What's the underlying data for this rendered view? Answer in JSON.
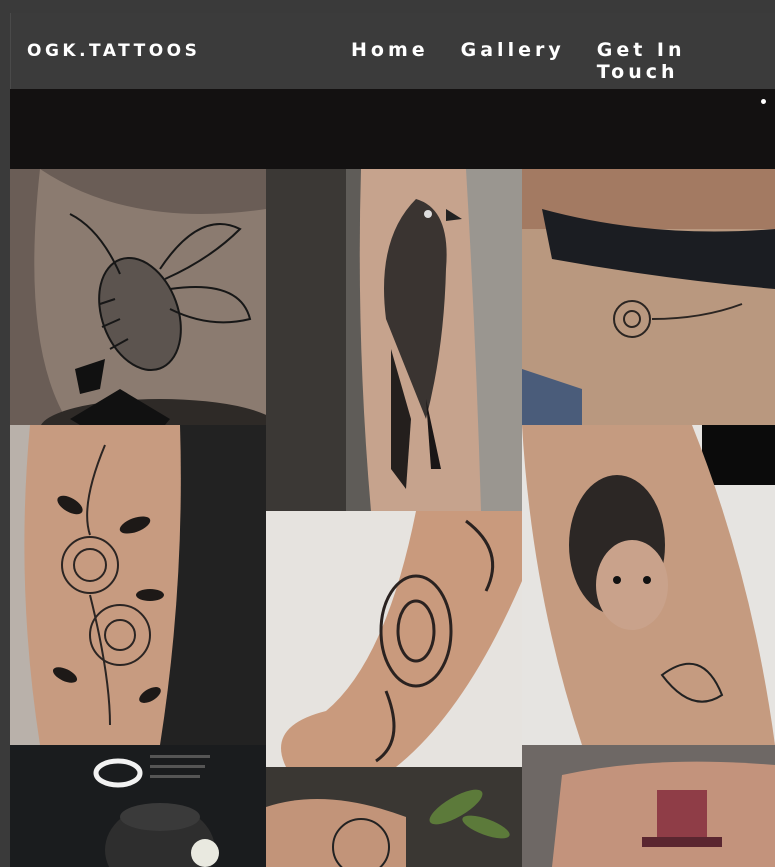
{
  "brand": "OGK.TATTOOS",
  "nav": {
    "items": [
      {
        "label": "Home"
      },
      {
        "label": "Gallery"
      },
      {
        "label": "Get In Touch"
      }
    ]
  },
  "colors": {
    "header_bg": "#3b3b3b",
    "hero_bg": "#131111",
    "text": "#ffffff"
  },
  "gallery": [
    {
      "subject": "bee tattoo on arm"
    },
    {
      "subject": "crow tattoo on forearm"
    },
    {
      "subject": "flower tattoo on ribs"
    },
    {
      "subject": "floral rose sleeve tattoo"
    },
    {
      "subject": "ornamental hand tattoo"
    },
    {
      "subject": "woman portrait with spider tattoo"
    },
    {
      "subject": "studio photo with ring light"
    },
    {
      "subject": "peony tattoo"
    },
    {
      "subject": "top hat tattoo"
    }
  ]
}
